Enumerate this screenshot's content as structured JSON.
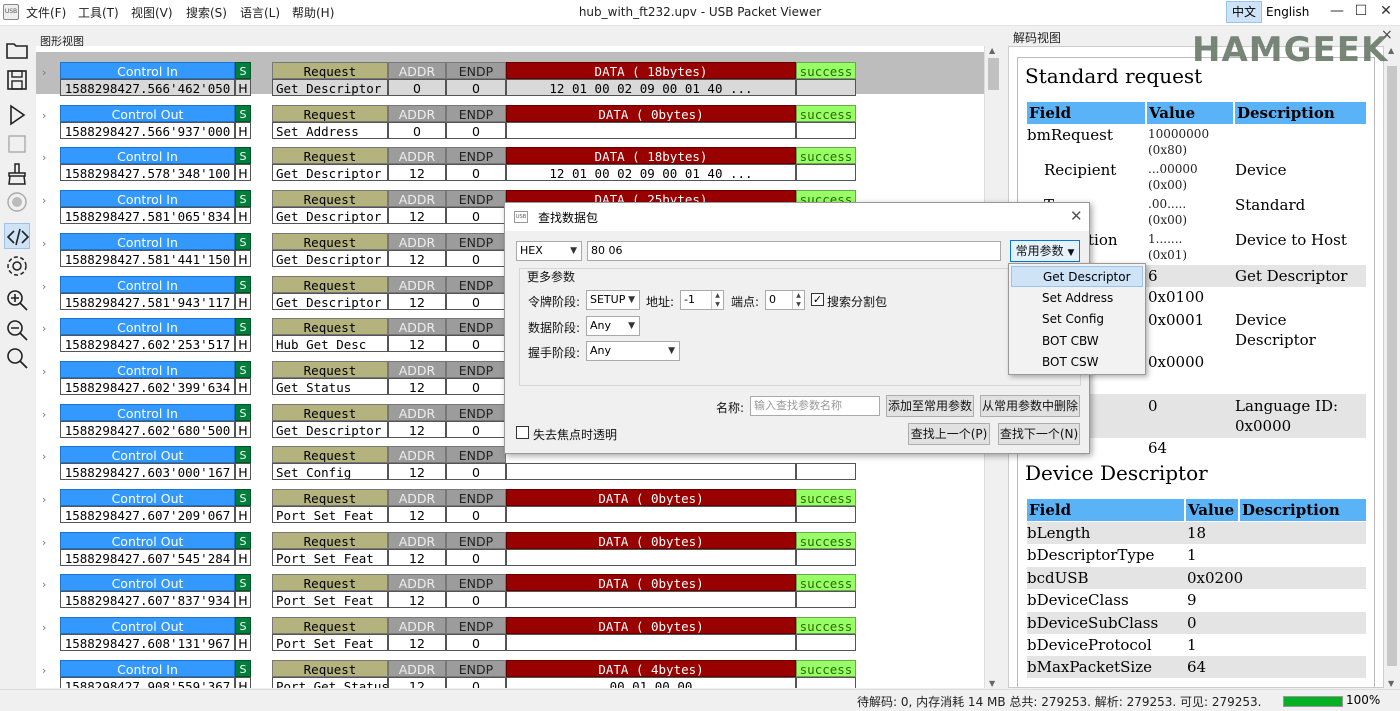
{
  "menubar": {
    "logo": "USB",
    "items": [
      "文件(F)",
      "工具(T)",
      "视图(V)",
      "搜索(S)",
      "语言(L)",
      "帮助(H)"
    ],
    "title": "hub_with_ft232.upv - USB Packet Viewer",
    "lang_zh": "中文",
    "lang_en": "English"
  },
  "toolbar": {
    "icons": [
      "open-folder-icon",
      "save-icon",
      "play-icon",
      "stop-icon",
      "clear-brush-icon",
      "record-icon",
      "code-view-icon",
      "settings-icon",
      "zoom-in-icon",
      "zoom-out-icon",
      "search-icon"
    ],
    "active": "code-view-icon"
  },
  "graph": {
    "label": "图形视图",
    "rows": [
      {
        "dir": "Control In",
        "s": "S",
        "ts": "1588298427.566'462'050",
        "h": "H",
        "req": "Request",
        "cmd": "Get Descriptor",
        "addr_label": "ADDR",
        "addr": "0",
        "endp_label": "ENDP",
        "endp": "0",
        "data": "DATA ( 18bytes)",
        "bytes": "12 01 00 02 09 00 01 40 ...",
        "status": "success",
        "selected": true
      },
      {
        "dir": "Control Out",
        "s": "S",
        "ts": "1588298427.566'937'000",
        "h": "H",
        "req": "Request",
        "cmd": "Set Address",
        "addr_label": "ADDR",
        "addr": "0",
        "endp_label": "ENDP",
        "endp": "0",
        "data": "DATA ( 0bytes)",
        "bytes": "",
        "status": "success"
      },
      {
        "dir": "Control In",
        "s": "S",
        "ts": "1588298427.578'348'100",
        "h": "H",
        "req": "Request",
        "cmd": "Get Descriptor",
        "addr_label": "ADDR",
        "addr": "12",
        "endp_label": "ENDP",
        "endp": "0",
        "data": "DATA ( 18bytes)",
        "bytes": "12 01 00 02 09 00 01 40 ...",
        "status": "success"
      },
      {
        "dir": "Control In",
        "s": "S",
        "ts": "1588298427.581'065'834",
        "h": "H",
        "req": "Request",
        "cmd": "Get Descriptor",
        "addr_label": "ADDR",
        "addr": "12",
        "endp_label": "ENDP",
        "endp": "0",
        "data": "DATA ( 25bytes)",
        "bytes": "",
        "status": "success"
      },
      {
        "dir": "Control In",
        "s": "S",
        "ts": "1588298427.581'441'150",
        "h": "H",
        "req": "Request",
        "cmd": "Get Descriptor",
        "addr_label": "ADDR",
        "addr": "12",
        "endp_label": "ENDP",
        "endp": "0",
        "data": "",
        "bytes": "",
        "status": ""
      },
      {
        "dir": "Control In",
        "s": "S",
        "ts": "1588298427.581'943'117",
        "h": "H",
        "req": "Request",
        "cmd": "Get Descriptor",
        "addr_label": "ADDR",
        "addr": "12",
        "endp_label": "ENDP",
        "endp": "0",
        "data": "",
        "bytes": "",
        "status": ""
      },
      {
        "dir": "Control In",
        "s": "S",
        "ts": "1588298427.602'253'517",
        "h": "H",
        "req": "Request",
        "cmd": "Hub Get Desc",
        "addr_label": "ADDR",
        "addr": "12",
        "endp_label": "ENDP",
        "endp": "0",
        "data": "",
        "bytes": "",
        "status": ""
      },
      {
        "dir": "Control In",
        "s": "S",
        "ts": "1588298427.602'399'634",
        "h": "H",
        "req": "Request",
        "cmd": "Get Status",
        "addr_label": "ADDR",
        "addr": "12",
        "endp_label": "ENDP",
        "endp": "0",
        "data": "",
        "bytes": "",
        "status": ""
      },
      {
        "dir": "Control In",
        "s": "S",
        "ts": "1588298427.602'680'500",
        "h": "H",
        "req": "Request",
        "cmd": "Get Descriptor",
        "addr_label": "ADDR",
        "addr": "12",
        "endp_label": "ENDP",
        "endp": "0",
        "data": "",
        "bytes": "",
        "status": ""
      },
      {
        "dir": "Control Out",
        "s": "S",
        "ts": "1588298427.603'000'167",
        "h": "H",
        "req": "Request",
        "cmd": "Set Config",
        "addr_label": "ADDR",
        "addr": "12",
        "endp_label": "ENDP",
        "endp": "0",
        "data": "",
        "bytes": "",
        "status": ""
      },
      {
        "dir": "Control Out",
        "s": "S",
        "ts": "1588298427.607'209'067",
        "h": "H",
        "req": "Request",
        "cmd": "Port Set Feat",
        "addr_label": "ADDR",
        "addr": "12",
        "endp_label": "ENDP",
        "endp": "0",
        "data": "DATA ( 0bytes)",
        "bytes": "",
        "status": "success"
      },
      {
        "dir": "Control Out",
        "s": "S",
        "ts": "1588298427.607'545'284",
        "h": "H",
        "req": "Request",
        "cmd": "Port Set Feat",
        "addr_label": "ADDR",
        "addr": "12",
        "endp_label": "ENDP",
        "endp": "0",
        "data": "DATA ( 0bytes)",
        "bytes": "",
        "status": "success"
      },
      {
        "dir": "Control Out",
        "s": "S",
        "ts": "1588298427.607'837'934",
        "h": "H",
        "req": "Request",
        "cmd": "Port Set Feat",
        "addr_label": "ADDR",
        "addr": "12",
        "endp_label": "ENDP",
        "endp": "0",
        "data": "DATA ( 0bytes)",
        "bytes": "",
        "status": "success"
      },
      {
        "dir": "Control Out",
        "s": "S",
        "ts": "1588298427.608'131'967",
        "h": "H",
        "req": "Request",
        "cmd": "Port Set Feat",
        "addr_label": "ADDR",
        "addr": "12",
        "endp_label": "ENDP",
        "endp": "0",
        "data": "DATA ( 0bytes)",
        "bytes": "",
        "status": "success"
      },
      {
        "dir": "Control In",
        "s": "S",
        "ts": "1588298427.908'559'367",
        "h": "H",
        "req": "Request",
        "cmd": "Port Get Status",
        "addr_label": "ADDR",
        "addr": "12",
        "endp_label": "ENDP",
        "endp": "0",
        "data": "DATA ( 4bytes)",
        "bytes": "00 01 00 00",
        "status": "success"
      }
    ]
  },
  "decode": {
    "label": "解码视图",
    "close": "×",
    "watermark": "HAMGEEK",
    "sec1_title": "Standard request",
    "h_field": "Field",
    "h_value": "Value",
    "h_desc": "Description",
    "bmRequest": "bmRequest",
    "bm_val1": "10000000",
    "bm_val2": "(0x80)",
    "recipient": "Recipient",
    "rec_val1": "...00000",
    "rec_val2": "(0x00)",
    "rec_desc": "Device",
    "type_frag": "T",
    "type_val1": ".00.....",
    "type_val2": "(0x00)",
    "type_desc": "Standard",
    "dir_frag": "tion",
    "dir_val1": "1.......",
    "dir_val2": "(0x01)",
    "dir_desc": "Device to Host",
    "req_val": "6",
    "req_desc": "Get Descriptor",
    "wvalue_val": "0x0100",
    "windex_val": "0x0001",
    "windex_desc1": "Device",
    "windex_desc2": "Descriptor",
    "wlen_val": "0x0000",
    "lang_val": "0",
    "lang_desc1": "Language ID:",
    "lang_desc2": "0x0000",
    "len_val": "64",
    "sec2_title": "Device Descriptor",
    "dev_rows": [
      {
        "field": "bLength",
        "value": "18"
      },
      {
        "field": "bDescriptorType",
        "value": "1"
      },
      {
        "field": "bcdUSB",
        "value": "0x0200"
      },
      {
        "field": "bDeviceClass",
        "value": "9"
      },
      {
        "field": "bDeviceSubClass",
        "value": "0"
      },
      {
        "field": "bDeviceProtocol",
        "value": "1"
      },
      {
        "field": "bMaxPacketSize",
        "value": "64"
      }
    ]
  },
  "dialog": {
    "icon": "USB",
    "title": "查找数据包",
    "format": "HEX",
    "search_value": "80 06",
    "common_params": "常用参数",
    "more_params": "更多参数",
    "token_label": "令牌阶段:",
    "token_value": "SETUP",
    "addr_label": "地址:",
    "addr_value": "-1",
    "endp_label": "端点:",
    "endp_value": "0",
    "split_label": "搜索分割包",
    "data_label": "数据阶段:",
    "data_value": "Any",
    "handshake_label": "握手阶段:",
    "handshake_value": "Any",
    "name_label": "名称:",
    "name_placeholder": "输入查找参数名称",
    "add_button": "添加至常用参数",
    "remove_button": "从常用参数中删除",
    "transparent_label": "失去焦点时透明",
    "find_prev": "查找上一个(P)",
    "find_next": "查找下一个(N)"
  },
  "dropdown": {
    "items": [
      "Get Descriptor",
      "Set Address",
      "Set Config",
      "BOT CBW",
      "BOT CSW"
    ],
    "highlighted": "Get Descriptor"
  },
  "status": {
    "text": "待解码: 0, 内存消耗 14 MB 总共: 279253. 解析: 279253. 可见: 279253.",
    "progress": 100,
    "percent": "100%"
  }
}
